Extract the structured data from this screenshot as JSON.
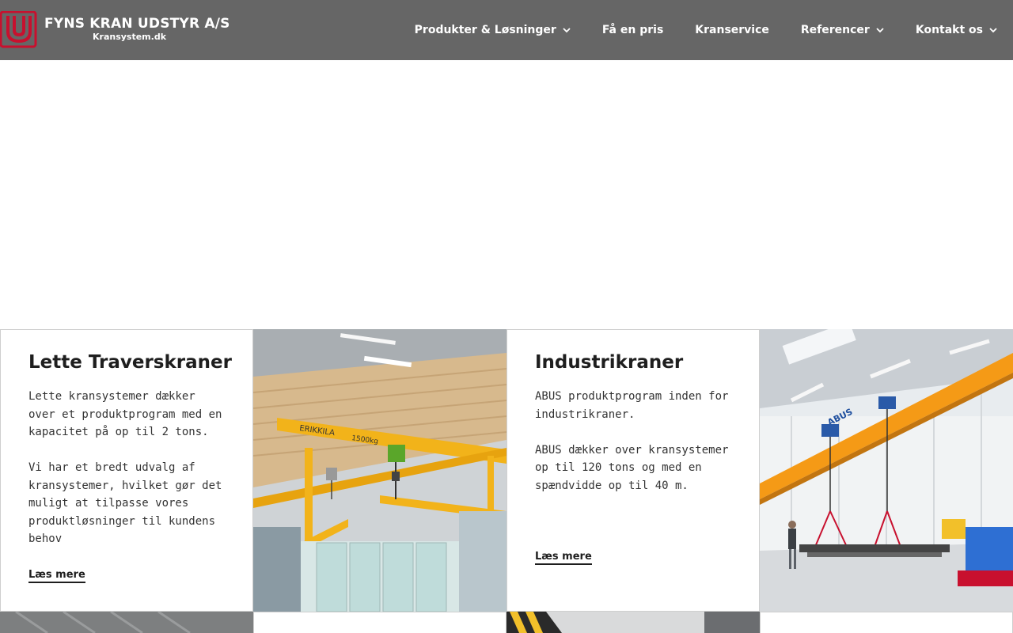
{
  "brand": {
    "title": "FYNS KRAN UDSTYR A/S",
    "subtitle": "Kransystem.dk",
    "mark_color": "#c8102e"
  },
  "nav": {
    "items": [
      {
        "label": "Produkter & Løsninger",
        "dropdown": true
      },
      {
        "label": "Få en pris",
        "dropdown": false
      },
      {
        "label": "Kranservice",
        "dropdown": false
      },
      {
        "label": "Referencer",
        "dropdown": true
      },
      {
        "label": "Kontakt os",
        "dropdown": true
      }
    ]
  },
  "cards": [
    {
      "title": "Lette Traverskraner",
      "body": "Lette kransystemer dækker over et produktprogram med en kapacitet på op til 2 tons.\n\nVi har et bredt udvalg af kransystemer, hvilket gør det muligt at tilpasse vores produktløsninger til kundens behov",
      "link": "Læs mere"
    },
    {
      "title": "Industrikraner",
      "body": "ABUS produktprogram inden for industrikraner.\n\nABUS dækker over kransystemer op til 120 tons og med en spændvidde op til 40 m.",
      "link": "Læs mere"
    }
  ],
  "images": {
    "crane_beam_label": "ERIKKILA",
    "crane_capacity_label": "1500kg",
    "crane2_brand": "ABUS"
  },
  "colors": {
    "header_bg": "#666666",
    "crane_yellow": "#f2b31a",
    "crane_orange": "#f59a16"
  }
}
